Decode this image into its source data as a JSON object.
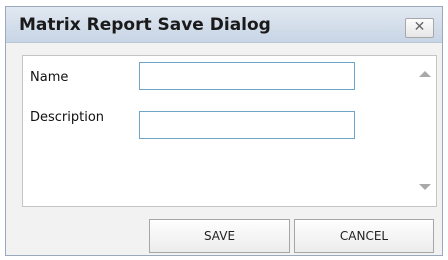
{
  "dialog": {
    "title": "Matrix Report Save Dialog",
    "close_label": "✕"
  },
  "form": {
    "name_label": "Name",
    "name_value": "",
    "description_label": "Description",
    "description_value": ""
  },
  "buttons": {
    "save_label": "SAVE",
    "cancel_label": "CANCEL"
  },
  "colors": {
    "titlebar": "#c8d5e5",
    "field_border": "#6ea5c7"
  },
  "icons": {
    "close": "close-icon",
    "scroll_up": "scroll-up-arrow-icon",
    "scroll_down": "scroll-down-arrow-icon"
  }
}
